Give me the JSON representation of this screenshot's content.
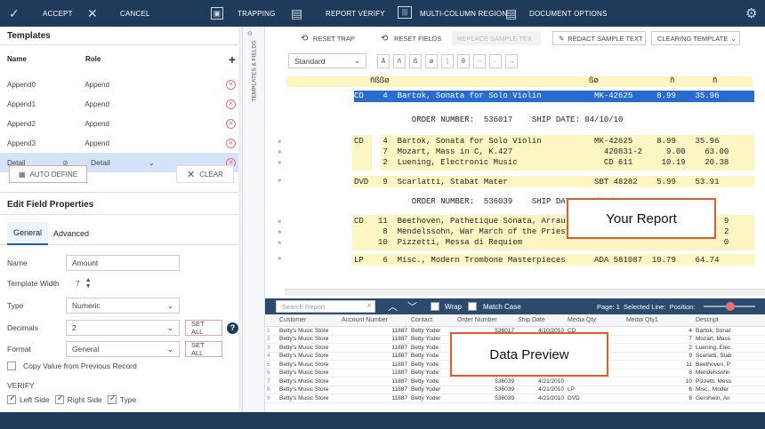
{
  "topbar": {
    "accept": "ACCEPT",
    "cancel": "CANCEL",
    "trapping": "TRAPPING",
    "report_verify": "REPORT VERIFY",
    "multi_column": "MULTI-COLUMN REGION",
    "document_options": "DOCUMENT OPTIONS"
  },
  "templates": {
    "title": "Templates",
    "col_name": "Name",
    "col_role": "Role",
    "rows": [
      {
        "name": "Append0",
        "role": "Append"
      },
      {
        "name": "Append1",
        "role": "Append"
      },
      {
        "name": "Append2",
        "role": "Append"
      },
      {
        "name": "Append3",
        "role": "Append"
      }
    ],
    "selected": {
      "name": "Detail",
      "role": "Detail"
    },
    "auto_define": "AUTO DEFINE",
    "clear": "CLEAR"
  },
  "side_label": "TEMPLATES & FIELDS",
  "edit_field": {
    "title": "Edit Field Properties",
    "tab_general": "General",
    "tab_advanced": "Advanced",
    "name_label": "Name",
    "name_value": "Amount",
    "width_label": "Template Width",
    "width_value": "7",
    "type_label": "Type",
    "type_value": "Numeric",
    "decimals_label": "Decimals",
    "decimals_value": "2",
    "format_label": "Format",
    "format_value": "General",
    "set_all": "SET ALL",
    "copy_value": "Copy Value from Previous Record",
    "verify": "VERIFY",
    "left_side": "Left Side",
    "right_side": "Right Side",
    "type_chk": "Type"
  },
  "toolbar": {
    "reset_trap": "RESET TRAP",
    "reset_fields": "RESET FIELDS",
    "replace_sample": "REPLACE SAMPLE TEX",
    "redact_sample": "REDACT SAMPLE TEXT",
    "clearing_template": "CLEARING TEMPLATE",
    "standard": "Standard"
  },
  "report": {
    "header_cols": [
      "ñßßø",
      "ßø",
      "ñ",
      "ñ"
    ],
    "lines": [
      {
        "text": "CD    4  Bartok, Sonata for Solo Violin           MK-42625     8.99    35.96"
      },
      {
        "text": "            ORDER NUMBER:  536017    SHIP DATE: 04/10/10"
      },
      {
        "text": "CD    4  Bartok, Sonata for Solo Violin           MK-42625     8.99    35.96"
      },
      {
        "text": "      7  Mozart, Mass in C, K.427                   420831-2     9.00    63.00"
      },
      {
        "text": "      2  Luening, Electronic Music                  CD 611      10.19    20.38"
      },
      {
        "text": "DVD   9  Scarlatti, Stabat Mater                  SBT 48282    5.99    53.91"
      },
      {
        "text": "            ORDER NUMBER:  536039    SHIP DATE: 04/21/10"
      },
      {
        "text": "CD   11  Beethoven, Pathetique Sonata, Arrau                                 9"
      },
      {
        "text": "      8  Mendelssohn, War March of the Priests                               2"
      },
      {
        "text": "     10  Pizzetti, Messa di Requiem                                          0"
      },
      {
        "text": "LP    6  Misc., Modern Trombone Masterpieces      ADA 581087  10.79    64.74"
      }
    ]
  },
  "search": {
    "placeholder": "Search Report",
    "wrap": "Wrap",
    "match_case": "Match Case",
    "page": "Page: 1  Selected Line:  Position:"
  },
  "grid": {
    "headers": [
      "Customer",
      "Account Number",
      "Contact",
      "Order Number",
      "Ship Date",
      "Media Qty",
      "Media Qty1",
      "Descript"
    ],
    "rows": [
      [
        "Betty's Music Store",
        "11887",
        "Betty Yoder",
        "536017",
        "4/10/2010",
        "CD",
        "4",
        "Bartok, Sonat"
      ],
      [
        "Betty's Music Store",
        "11887",
        "Betty Yoder",
        "536017",
        "4/10/2010",
        "",
        "7",
        "Mozart, Mass"
      ],
      [
        "Betty's Music Store",
        "11887",
        "Betty Yode",
        "",
        "",
        "",
        "2",
        "Luening, Elec"
      ],
      [
        "Betty's Music Store",
        "11887",
        "Betty Yode",
        "",
        "",
        "DVD",
        "9",
        "Scarlatti, Stab"
      ],
      [
        "Betty's Music Store",
        "11887",
        "Betty Yode",
        "",
        "",
        "D",
        "11",
        "Beethoven, P"
      ],
      [
        "Betty's Music Store",
        "11887",
        "Betty Yode",
        "",
        "",
        "",
        "8",
        "Mendelssohn"
      ],
      [
        "Betty's Music Store",
        "11887",
        "Betty Yode",
        "536039",
        "4/21/2010",
        "",
        "10",
        "Pizzetti, Mess"
      ],
      [
        "Betty's Music Store",
        "11887",
        "Betty Yoder",
        "536039",
        "4/21/2010",
        "LP",
        "6",
        "Misc., Moder"
      ],
      [
        "Betty's Music Store",
        "11887",
        "Betty Yoder",
        "536039",
        "4/21/2010",
        "DVD",
        "6",
        "Gershwin, An"
      ]
    ]
  },
  "callouts": {
    "report": "Your Report",
    "preview": "Data Preview"
  }
}
